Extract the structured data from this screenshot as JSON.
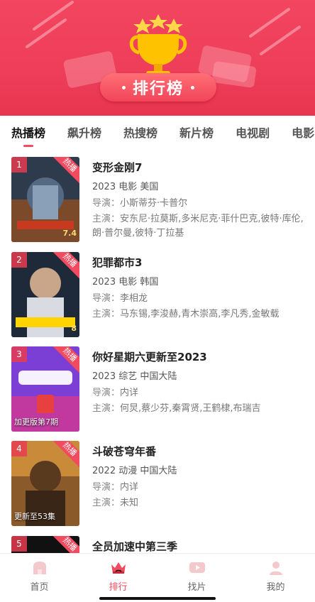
{
  "banner": {
    "title": "排行榜"
  },
  "tabs": [
    "热播榜",
    "飙升榜",
    "热搜榜",
    "新片榜",
    "电视剧",
    "电影"
  ],
  "items": [
    {
      "rank": "1",
      "hot": "热播",
      "title": "变形金刚7",
      "year": "2023",
      "type": "电影",
      "region": "美国",
      "director_label": "导演：",
      "director": "小斯蒂芬·卡普尔",
      "cast_label": "主演：",
      "cast": "安东尼·拉莫斯,多米尼克·菲什巴克,彼特·库伦,朗·普尔曼,彼特·丁拉基",
      "poster_score": "7.4",
      "poster_badge": ""
    },
    {
      "rank": "2",
      "hot": "热播",
      "title": "犯罪都市3",
      "year": "2023",
      "type": "电影",
      "region": "韩国",
      "director_label": "导演：",
      "director": "李相龙",
      "cast_label": "主演：",
      "cast": "马东锡,李浚赫,青木崇高,李凡秀,金敏载",
      "poster_score": "8",
      "poster_badge": ""
    },
    {
      "rank": "3",
      "hot": "热播",
      "title": "你好星期六更新至2023",
      "year": "2023",
      "type": "综艺",
      "region": "中国大陆",
      "director_label": "导演：",
      "director": "内详",
      "cast_label": "主演：",
      "cast": "何炅,蔡少芬,秦霄贤,王鹤棣,布瑞吉",
      "poster_score": "",
      "poster_badge": "加更版第7期"
    },
    {
      "rank": "4",
      "hot": "热播",
      "title": "斗破苍穹年番",
      "year": "2022",
      "type": "动漫",
      "region": "中国大陆",
      "director_label": "导演：",
      "director": "内详",
      "cast_label": "主演：",
      "cast": "未知",
      "poster_score": "",
      "poster_badge": "更新至53集"
    },
    {
      "rank": "5",
      "hot": "热播",
      "title": "全员加速中第三季"
    }
  ],
  "nav": [
    {
      "label": "首页",
      "icon": "home-icon"
    },
    {
      "label": "排行",
      "icon": "crown-icon"
    },
    {
      "label": "找片",
      "icon": "play-icon"
    },
    {
      "label": "我的",
      "icon": "user-icon"
    }
  ],
  "colors": {
    "accent": "#f14b5f",
    "banner": "#ee3e5a",
    "trophy": "#ffc200"
  }
}
